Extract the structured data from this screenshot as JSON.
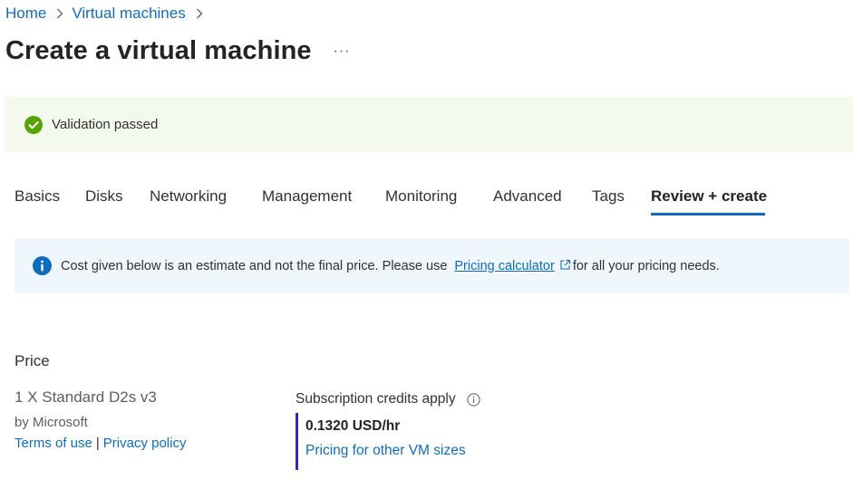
{
  "breadcrumb": {
    "items": [
      "Home",
      "Virtual machines"
    ]
  },
  "title": "Create a virtual machine",
  "more_label": "···",
  "validation": {
    "text": "Validation passed",
    "color": "#57a300"
  },
  "tabs": [
    {
      "label": "Basics"
    },
    {
      "label": "Disks"
    },
    {
      "label": "Networking"
    },
    {
      "label": "Management"
    },
    {
      "label": "Monitoring"
    },
    {
      "label": "Advanced"
    },
    {
      "label": "Tags"
    },
    {
      "label": "Review + create",
      "active": true
    }
  ],
  "info_bar": {
    "text_before": "Cost given below is an estimate and not the final price. Please use",
    "link_text": "Pricing calculator",
    "text_after": "for all your pricing needs.",
    "icon": "info-icon"
  },
  "price": {
    "section_title": "Price",
    "product": "1 X Standard D2s v3",
    "publisher": "by Microsoft",
    "terms_link": "Terms of use",
    "separator": "|",
    "privacy_link": "Privacy policy",
    "credits_label": "Subscription credits apply",
    "rate": "0.1320 USD/hr",
    "other_sizes_link": "Pricing for other VM sizes"
  },
  "colors": {
    "accent": "#0f6cbd",
    "price_bar": "#3a27b8",
    "success_bg": "#f4f9ee",
    "info_bg": "#eff6fc"
  }
}
